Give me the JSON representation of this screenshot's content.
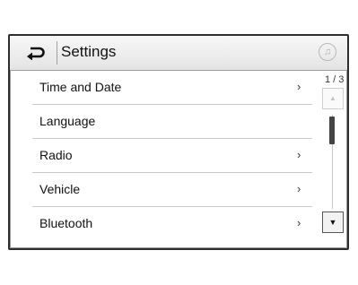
{
  "header": {
    "title": "Settings",
    "back_icon": "back-arrow-icon",
    "media_icon": "music-note-icon",
    "media_glyph": "♫"
  },
  "list": {
    "items": [
      {
        "label": "Time and Date",
        "chevron": "›"
      },
      {
        "label": "Language",
        "chevron": ""
      },
      {
        "label": "Radio",
        "chevron": "›"
      },
      {
        "label": "Vehicle",
        "chevron": "›"
      },
      {
        "label": "Bluetooth",
        "chevron": "›"
      }
    ]
  },
  "scroll": {
    "page_indicator": "1 / 3",
    "current_page": 1,
    "total_pages": 3,
    "up_glyph": "▲",
    "down_glyph": "▼"
  }
}
